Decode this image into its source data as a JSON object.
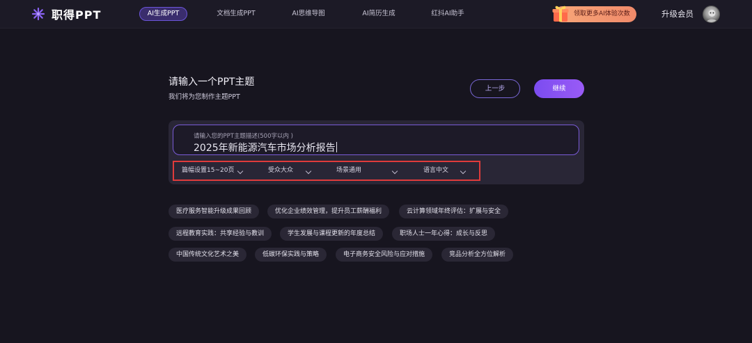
{
  "header": {
    "logo_text": "职得PPT",
    "tabs": [
      {
        "label": "AI生成PPT",
        "active": true
      },
      {
        "label": "文档生成PPT",
        "active": false
      },
      {
        "label": "AI思维导图",
        "active": false
      },
      {
        "label": "AI简历生成",
        "active": false
      },
      {
        "label": "红抖AI助手",
        "active": false
      }
    ],
    "promo_label": "领取更多AI体验次数",
    "upgrade_label": "升级会员"
  },
  "main": {
    "title": "请输入一个PPT主题",
    "subtitle": "我们将为您制作主题PPT",
    "prev_button": "上一步",
    "next_button": "继续",
    "input": {
      "placeholder": "请输入您的PPT主题描述(500字以内 )",
      "value": "2025年新能源汽车市场分析报告"
    },
    "options": [
      {
        "label": "篇幅设置15~20页"
      },
      {
        "label": "受众大众"
      },
      {
        "label": "场景通用"
      },
      {
        "label": "语言中文"
      }
    ],
    "suggestions": [
      "医疗服务智能升级成果回顾",
      "优化企业绩效管理，提升员工薪酬福利",
      "云计算领域年终评估：扩展与安全",
      "远程教育实践：共享经验与教训",
      "学生发展与课程更新的年度总结",
      "职场人士一年心得：成长与反思",
      "中国传统文化艺术之美",
      "低碳环保实践与策略",
      "电子商务安全风险与应对措施",
      "竞品分析全方位解析"
    ]
  },
  "colors": {
    "background": "#17151f",
    "accent": "#7b4cf0",
    "highlight_border": "#e03b3b",
    "promo": "#f08a6a"
  },
  "icons": [
    "logo-icon",
    "gift-icon",
    "chevron-down-icon",
    "avatar"
  ]
}
